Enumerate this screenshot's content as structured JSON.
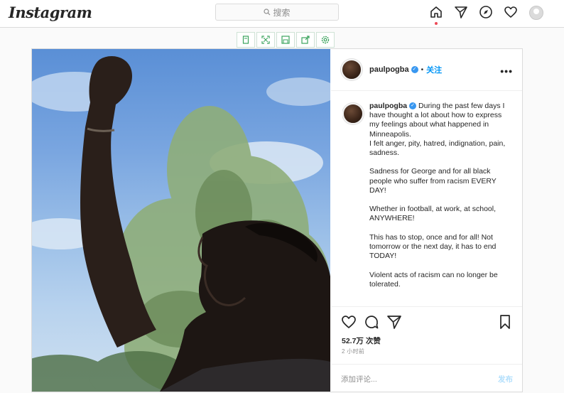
{
  "topbar": {
    "logo": "Instagram",
    "search": {
      "placeholder": "搜索",
      "icon": "search-icon"
    },
    "nav": [
      {
        "name": "home-icon",
        "active": true
      },
      {
        "name": "direct-message-icon"
      },
      {
        "name": "explore-icon"
      },
      {
        "name": "activity-heart-icon"
      },
      {
        "name": "profile-avatar"
      }
    ]
  },
  "toolbar": {
    "icons": [
      "bookmark-page-icon",
      "fullscreen-icon",
      "save-image-icon",
      "share-icon",
      "settings-icon"
    ],
    "color": "#3aa35c"
  },
  "post": {
    "username": "paulpogba",
    "verified": true,
    "follow_separator": "•",
    "follow_label": "关注",
    "more_label": "•••",
    "caption_paragraphs": [
      "During the past few days I have thought a lot about how to express my feelings about what happened in Minneapolis.\nI felt anger, pity, hatred, indignation, pain, sadness.",
      "Sadness for George and for all black people who suffer from racism EVERY DAY!",
      "Whether in football, at work, at school, ANYWHERE!",
      "This has to stop, once and for all! Not tomorrow or the next day, it has to end TODAY!",
      "Violent acts of racism can no longer be tolerated."
    ],
    "likes": "52.7万 次赞",
    "time": "2 小时前",
    "comment_placeholder": "添加评论...",
    "post_button": "发布"
  },
  "colors": {
    "accent": "#0095f6",
    "verified": "#3897f0",
    "notification": "#ed4956"
  }
}
